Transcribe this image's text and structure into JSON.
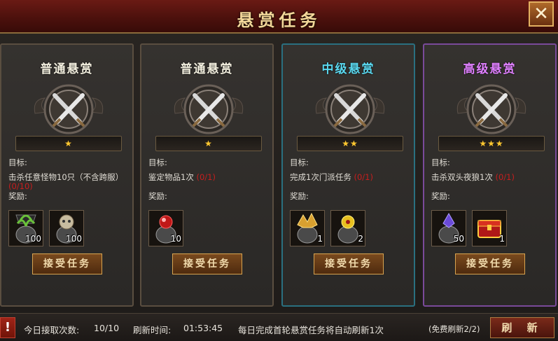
{
  "header": {
    "title": "悬赏任务"
  },
  "cards": [
    {
      "title": "普通悬赏",
      "stars": "★",
      "goal_label": "目标:",
      "task": "击杀任意怪物10只（不含跨服）",
      "progress": "(0/10)",
      "reward_label": "奖励:",
      "accept_label": "接受任务",
      "items": [
        {
          "icon": "green-herb-icon",
          "qty": "100"
        },
        {
          "icon": "bone-skull-icon",
          "qty": "100"
        }
      ]
    },
    {
      "title": "普通悬赏",
      "stars": "★",
      "goal_label": "目标:",
      "task": "鉴定物品1次",
      "progress": "(0/1)",
      "reward_label": "奖励:",
      "accept_label": "接受任务",
      "items": [
        {
          "icon": "red-gem-icon",
          "qty": "10"
        }
      ]
    },
    {
      "title": "中级悬赏",
      "stars": "★★",
      "goal_label": "目标:",
      "task": "完成1次门派任务",
      "progress": "(0/1)",
      "reward_label": "奖励:",
      "accept_label": "接受任务",
      "items": [
        {
          "icon": "gold-shards-icon",
          "qty": "1"
        },
        {
          "icon": "yellow-orb-icon",
          "qty": "2"
        }
      ]
    },
    {
      "title": "高级悬赏",
      "stars": "★★★",
      "goal_label": "目标:",
      "task": "击杀双头夜狼1次",
      "progress": "(0/1)",
      "reward_label": "奖励:",
      "accept_label": "接受任务",
      "items": [
        {
          "icon": "purple-crystal-icon",
          "qty": "50"
        },
        {
          "icon": "red-chest-icon",
          "qty": "1"
        }
      ]
    }
  ],
  "footer": {
    "daily_label": "今日接取次数:",
    "daily_value": "10/10",
    "refresh_label": "刷新时间:",
    "refresh_time": "01:53:45",
    "notice": "每日完成首轮悬赏任务将自动刷新1次",
    "free_refresh": "(免费刷新2/2)",
    "refresh_button": "刷 新"
  },
  "colors": {
    "progress_red": "#c81e1e",
    "star_gold": "#ffc830",
    "mid_title": "#5ad8f0",
    "high_title": "#e080ff"
  }
}
